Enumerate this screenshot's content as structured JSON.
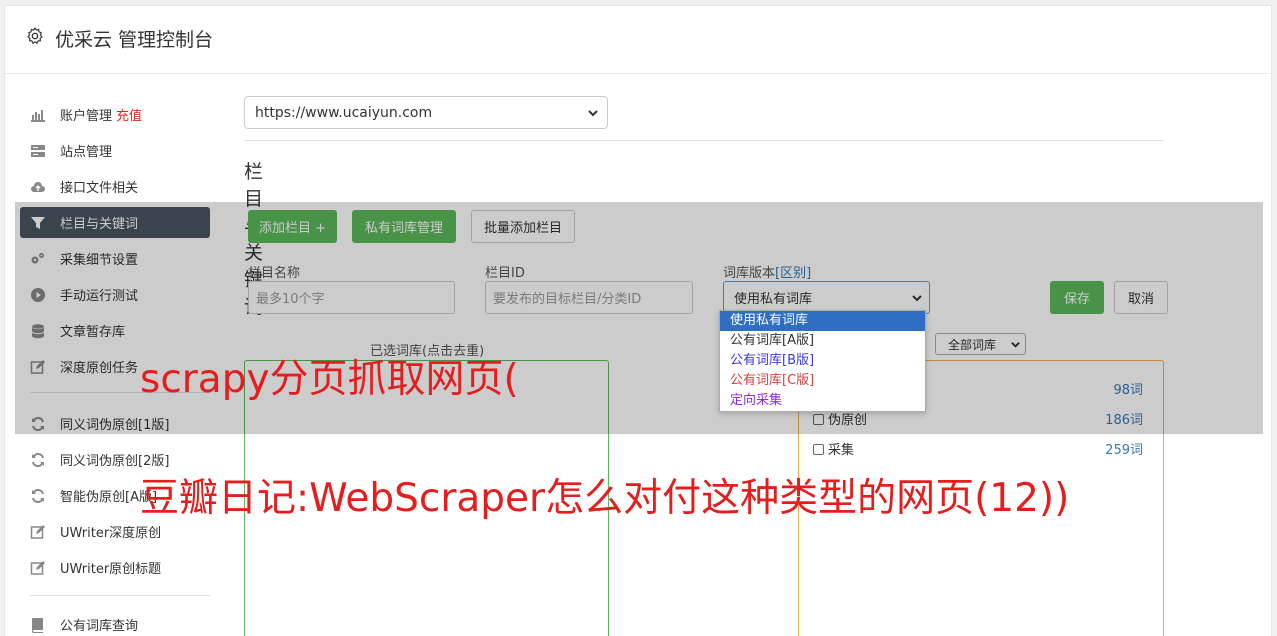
{
  "header": {
    "title": "优采云 管理控制台"
  },
  "sidebar": {
    "items": [
      {
        "label": "账户管理",
        "extra": "充值"
      },
      {
        "label": "站点管理"
      },
      {
        "label": "接口文件相关"
      },
      {
        "label": "栏目与关键词"
      },
      {
        "label": "采集细节设置"
      },
      {
        "label": "手动运行测试"
      },
      {
        "label": "文章暂存库"
      },
      {
        "label": "深度原创任务"
      },
      {
        "label": "同义词伪原创[1版]"
      },
      {
        "label": "同义词伪原创[2版]"
      },
      {
        "label": "智能伪原创[A版]"
      },
      {
        "label": "UWriter深度原创"
      },
      {
        "label": "UWriter原创标题"
      },
      {
        "label": "公有词库查询"
      }
    ],
    "active_index": 3
  },
  "main": {
    "site_select": "https://www.ucaiyun.com",
    "section_title": "栏目与关键词",
    "buttons": {
      "add_column": "添加栏目 +",
      "private_lib": "私有词库管理",
      "batch_add": "批量添加栏目",
      "save": "保存",
      "cancel": "取消"
    },
    "fields": {
      "name_label": "栏目名称",
      "name_placeholder": "最多10个字",
      "id_label": "栏目ID",
      "id_placeholder": "要发布的目标栏目/分类ID",
      "version_label": "词库版本",
      "version_link": "[区别]",
      "version_value": "使用私有词库"
    },
    "version_options": [
      {
        "label": "使用私有词库",
        "color": "#ffffff"
      },
      {
        "label": "公有词库[A版]",
        "color": "#333333"
      },
      {
        "label": "公有词库[B版]",
        "color": "#3a3ad6"
      },
      {
        "label": "公有词库[C版]",
        "color": "#d43f3a"
      },
      {
        "label": "定向采集",
        "color": "#8a2be2"
      }
    ],
    "selected_label": "已选词库(点击去重)",
    "all_libs_select": "全部词库",
    "libs": [
      {
        "name": "",
        "count": "98词"
      },
      {
        "name": "伪原创",
        "count": "186词"
      },
      {
        "name": "采集",
        "count": "259词"
      }
    ]
  },
  "watermark": {
    "line1": "scrapy分页抓取网页(",
    "line2": "豆瓣日记:WebScraper怎么对付这种类型的网页(12))"
  }
}
